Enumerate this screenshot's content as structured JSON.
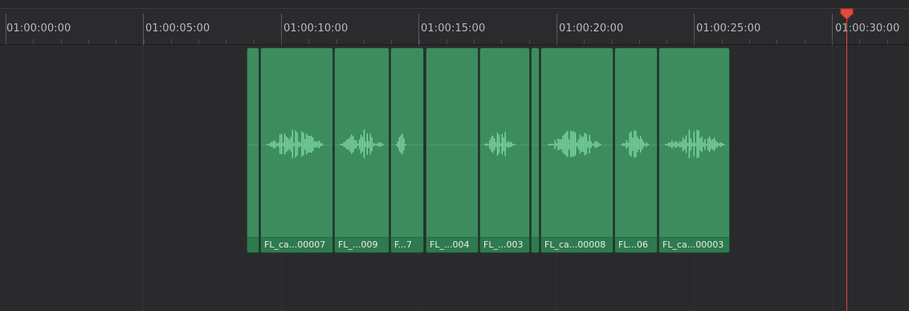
{
  "ruler": {
    "timecodes": [
      "01:00:00:00",
      "01:00:05:00",
      "01:00:10:00",
      "01:00:15:00",
      "01:00:20:00",
      "01:00:25:00",
      "01:00:30:00"
    ]
  },
  "clips": [
    {
      "label": ""
    },
    {
      "label": "FL_ca...00007"
    },
    {
      "label": "FL_...009"
    },
    {
      "label": "F...7"
    },
    {
      "label": "FL_...004"
    },
    {
      "label": "FL_...003"
    },
    {
      "label": ""
    },
    {
      "label": "FL_ca...00008"
    },
    {
      "label": "FL...06"
    },
    {
      "label": "FL_ca...00003"
    }
  ],
  "colors": {
    "clip_fill": "#3d8c5e",
    "waveform": "#7fd8a4",
    "playhead": "#e14a3c"
  },
  "playhead": {
    "icon": "playhead-marker-icon"
  }
}
